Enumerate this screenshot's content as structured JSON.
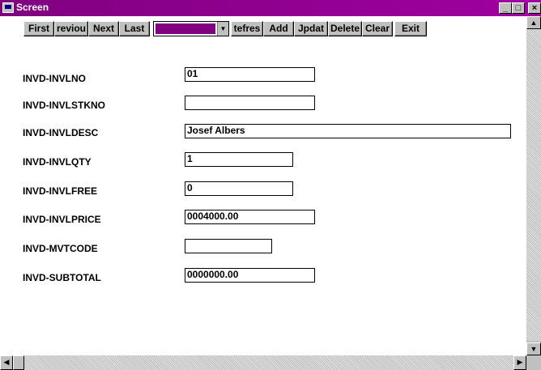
{
  "window": {
    "title": "Screen",
    "minimize_glyph": "_",
    "maximize_glyph": "□",
    "close_glyph": "×"
  },
  "toolbar": {
    "first": "First",
    "previous": "reviou",
    "next": "Next",
    "last": "Last",
    "combo_arrow": "▼",
    "refresh": "tefres",
    "add": "Add",
    "update": "Jpdat",
    "delete": "Delete",
    "clear": "Clear",
    "exit": "Exit",
    "combo_value_color": "#800080"
  },
  "fields": [
    {
      "label": "INVD-INVLNO",
      "value": "01"
    },
    {
      "label": "INVD-INVLSTKNO",
      "value": ""
    },
    {
      "label": "INVD-INVLDESC",
      "value": "Josef Albers"
    },
    {
      "label": "INVD-INVLQTY",
      "value": "1"
    },
    {
      "label": "INVD-INVLFREE",
      "value": "0"
    },
    {
      "label": "INVD-INVLPRICE",
      "value": "0004000.00"
    },
    {
      "label": "INVD-MVTCODE",
      "value": ""
    },
    {
      "label": "INVD-SUBTOTAL",
      "value": "0000000.00"
    }
  ],
  "scroll": {
    "up_glyph": "▲",
    "down_glyph": "▼",
    "left_glyph": "◀",
    "right_glyph": "▶"
  },
  "colors": {
    "titlebar": "#800080",
    "client_background": "#ffffff",
    "chrome": "#c0c0c0"
  }
}
